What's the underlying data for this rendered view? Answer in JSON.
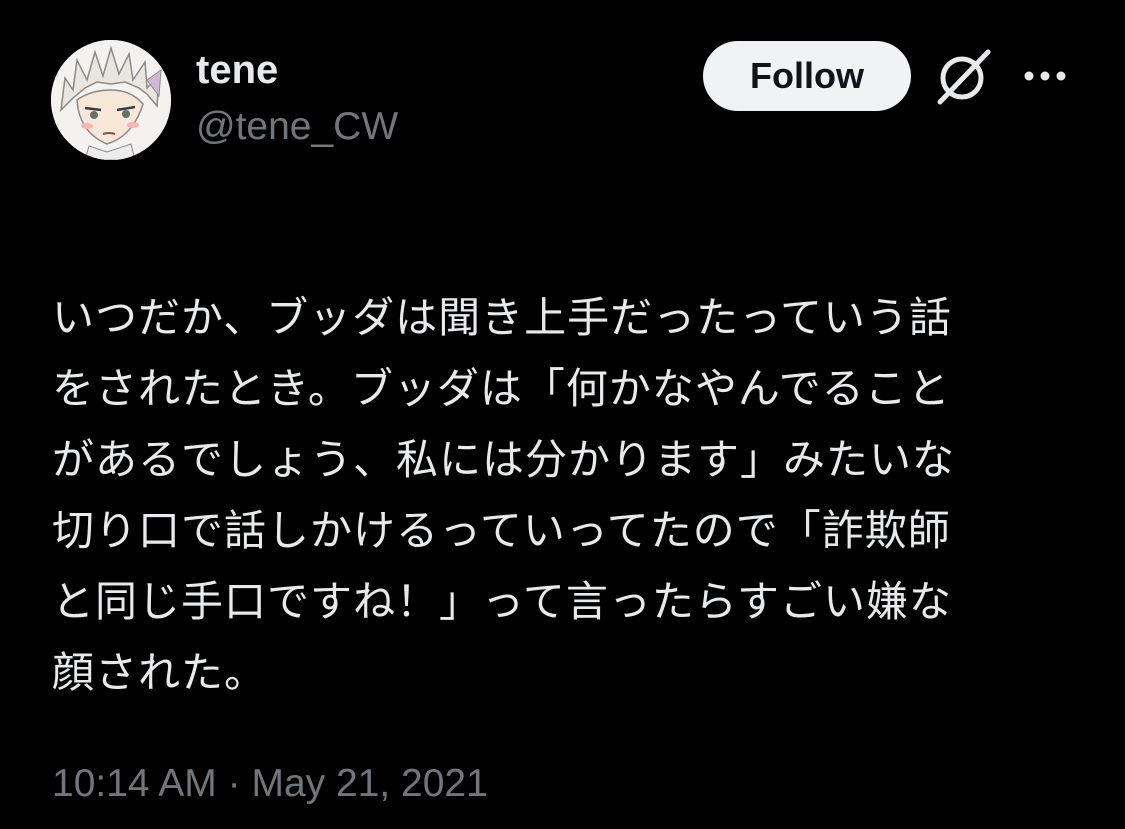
{
  "author": {
    "display_name": "tene",
    "handle": "@tene_CW",
    "avatar_icon": "anime-character-avatar"
  },
  "actions": {
    "follow_label": "Follow",
    "grok_icon": "grok-slash-icon",
    "more_icon": "more-horizontal-icon"
  },
  "tweet": {
    "text": "いつだか、ブッダは聞き上手だったっていう話\nをされたとき。ブッダは「何かなやんでること\nがあるでしょう、私には分かります」みたいな\n切り口で話しかけるっていってたので「詐欺師\nと同じ手口ですね！」って言ったらすごい嫌な\n顔された。",
    "time": "10:14 AM",
    "separator": "·",
    "date": "May 21, 2021"
  },
  "colors": {
    "background": "#000000",
    "primary_text": "#e7e9ea",
    "secondary_text": "#71767b",
    "follow_button_bg": "#eff3f4",
    "follow_button_text": "#0f1419"
  }
}
